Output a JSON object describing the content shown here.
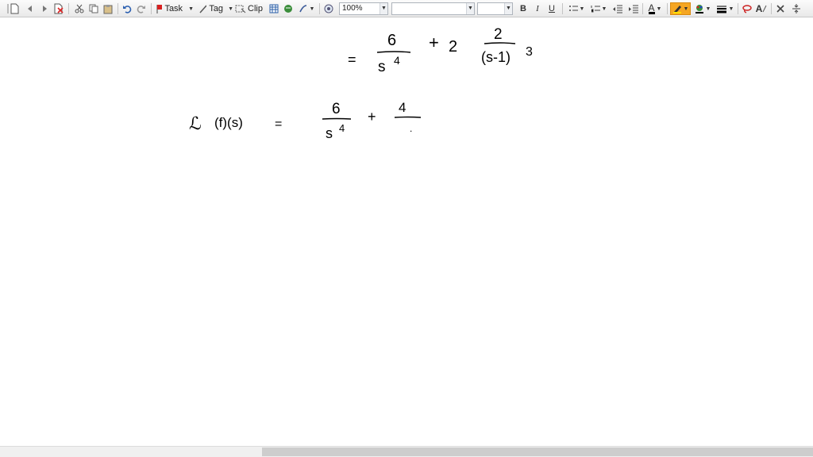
{
  "toolbar": {
    "task_label": "Task",
    "tag_label": "Tag",
    "clip_label": "Clip",
    "zoom_value": "100%",
    "font_name_value": "",
    "font_size_value": "",
    "bold": "B",
    "italic": "I",
    "underline": "U",
    "font_color_letter": "A",
    "clear_format": "A"
  },
  "ink": {
    "line1": {
      "eq": "=",
      "num1": "6",
      "den1": "s",
      "exp1": "4",
      "plus": "+",
      "coef": "2",
      "num2": "2",
      "den2": "(s-1)",
      "exp2": "3"
    },
    "line2": {
      "lhs": "ℒ",
      "lhs_args": "(f)(s)",
      "eq": "=",
      "num1": "6",
      "den1": "s",
      "exp1": "4",
      "plus": "+",
      "num2": "4",
      "den2_dot": "."
    }
  }
}
